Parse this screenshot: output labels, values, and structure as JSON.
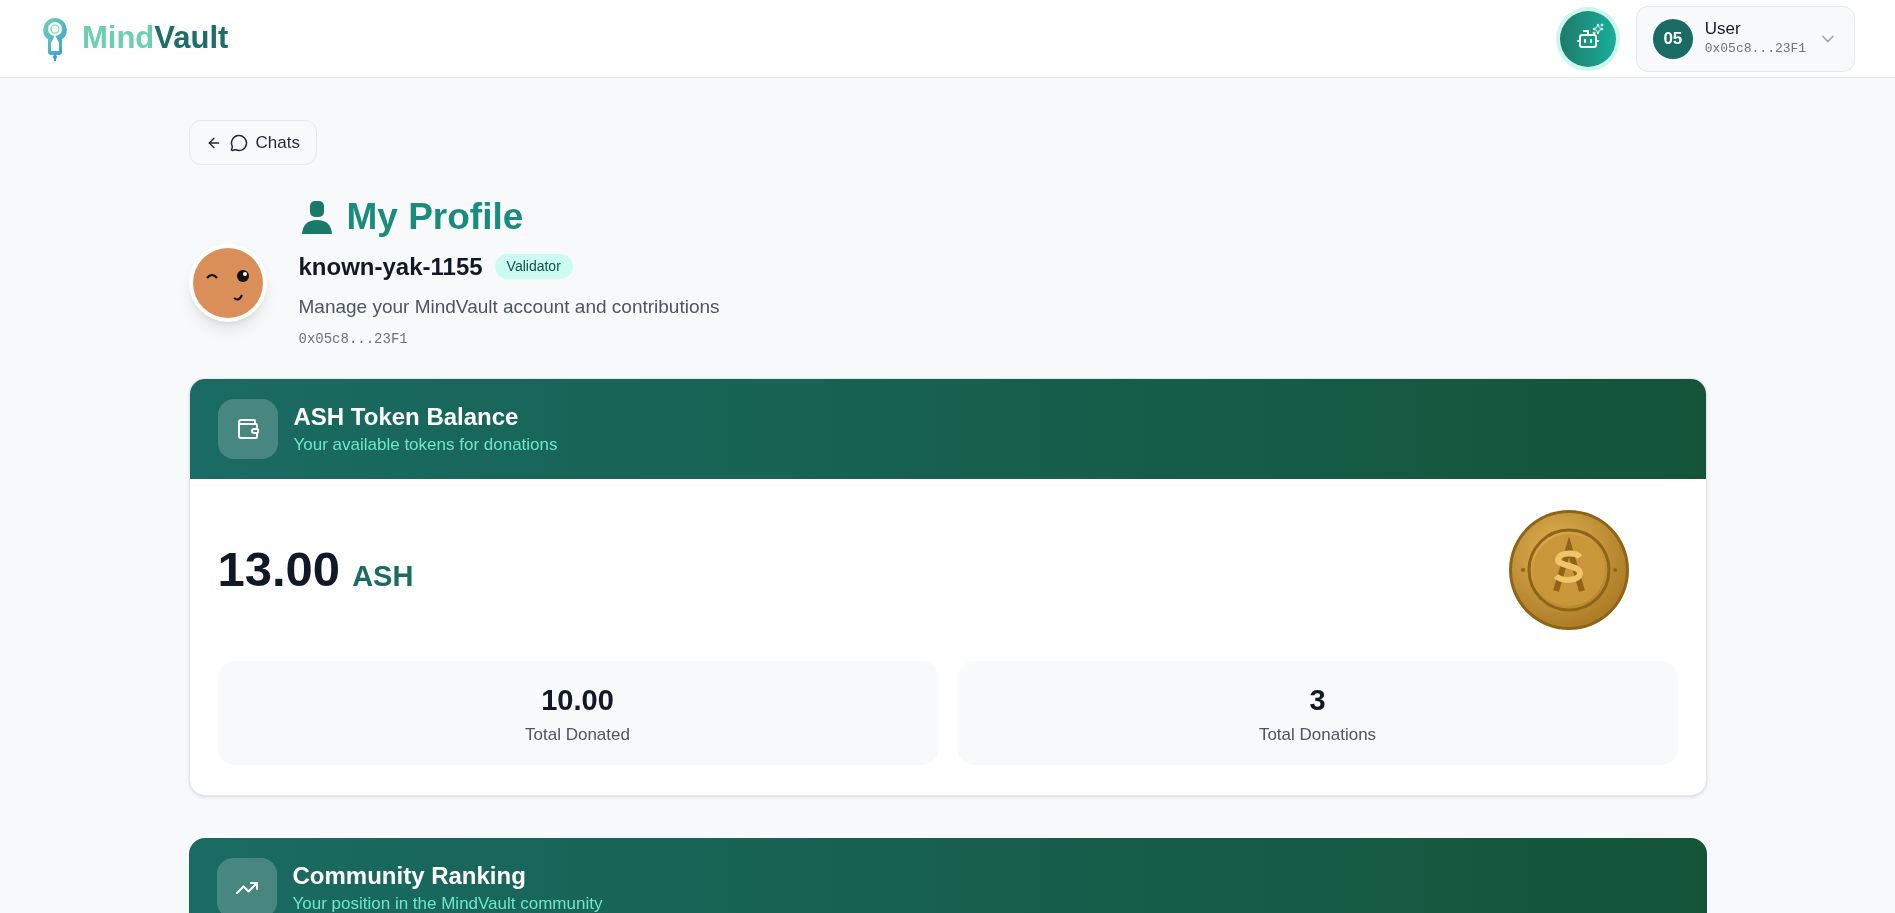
{
  "header": {
    "logo_text_1": "Mind",
    "logo_text_2": "Vault",
    "user_menu": {
      "initials": "05",
      "name": "User",
      "address": "0x05c8...23F1"
    }
  },
  "back_button": {
    "label": "Chats"
  },
  "profile": {
    "title": "My Profile",
    "username": "known-yak-1155",
    "role": "Validator",
    "description": "Manage your MindVault account and contributions",
    "address": "0x05c8...23F1"
  },
  "balance_card": {
    "title": "ASH Token Balance",
    "subtitle": "Your available tokens for donations",
    "amount": "13.00",
    "unit": "ASH",
    "stats": [
      {
        "value": "10.00",
        "label": "Total Donated"
      },
      {
        "value": "3",
        "label": "Total Donations"
      }
    ]
  },
  "ranking_card": {
    "title": "Community Ranking",
    "subtitle": "Your position in the MindVault community"
  }
}
